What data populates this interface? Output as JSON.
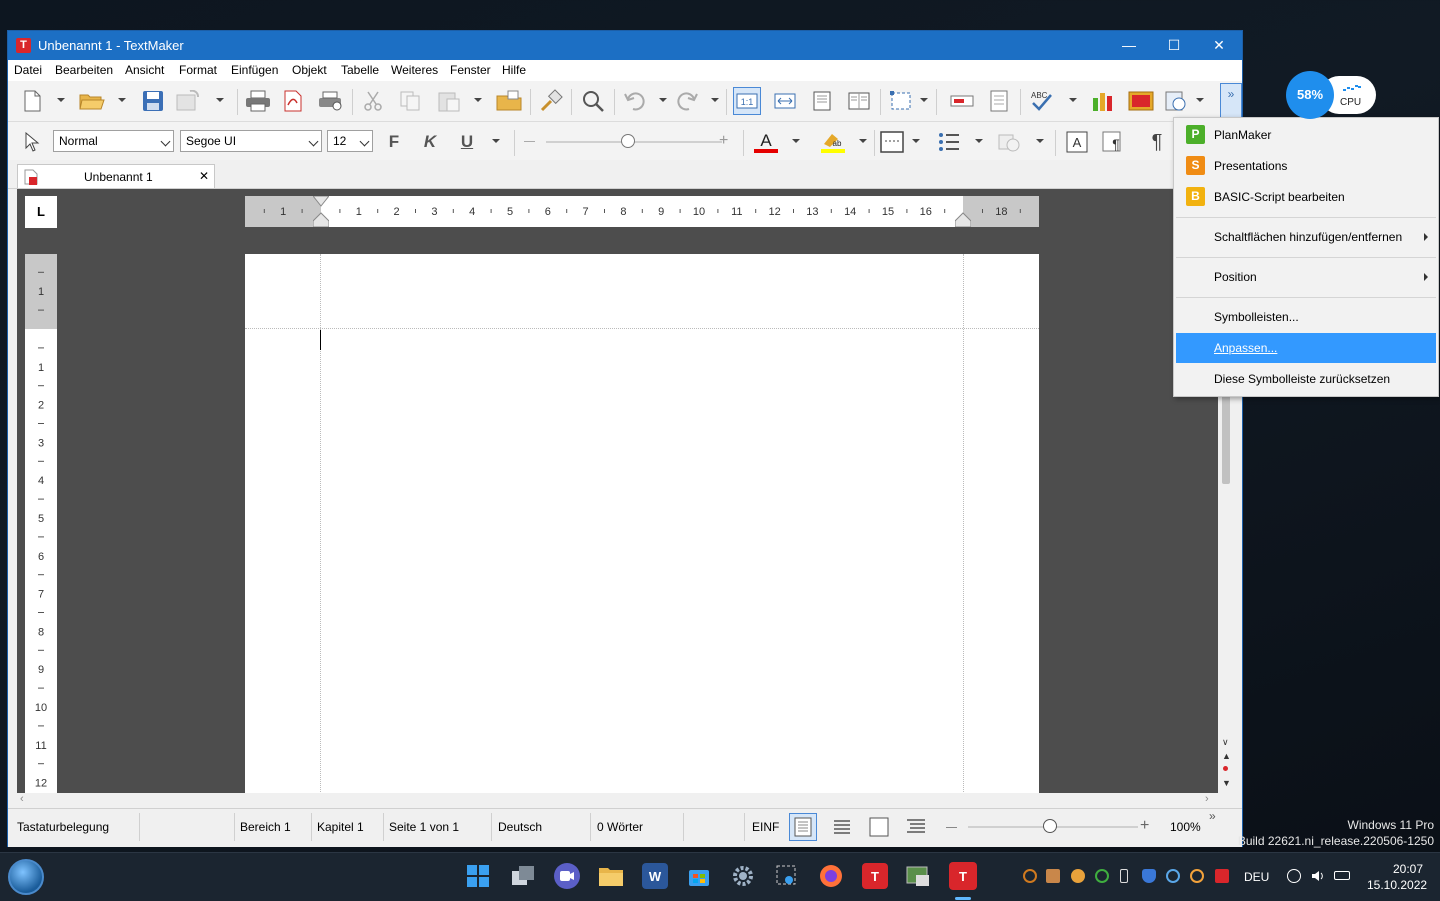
{
  "window": {
    "title": "Unbenannt 1 - TextMaker",
    "app_icon": "T",
    "controls": {
      "minimize": "—",
      "maximize": "☐",
      "close": "✕"
    }
  },
  "menu": [
    "Datei",
    "Bearbeiten",
    "Ansicht",
    "Format",
    "Einfügen",
    "Objekt",
    "Tabelle",
    "Weiteres",
    "Fenster",
    "Hilfe"
  ],
  "format_toolbar": {
    "style": "Normal",
    "font": "Segoe UI",
    "size": "12",
    "bold": "F",
    "italic": "K",
    "underline": "U"
  },
  "document_tab": {
    "label": "Unbenannt 1",
    "close": "✕"
  },
  "ruler": {
    "tab_stop_symbol": "L",
    "h_labels": [
      "1",
      "1",
      "2",
      "3",
      "4",
      "5",
      "6",
      "7",
      "8",
      "9",
      "10",
      "11",
      "12",
      "13",
      "14",
      "15",
      "16",
      "18"
    ],
    "v_labels": [
      "1",
      "1",
      "2",
      "3",
      "4",
      "5",
      "6",
      "7",
      "8",
      "9",
      "10",
      "11",
      "12"
    ]
  },
  "status_bar": {
    "keyboard": "Tastaturbelegung",
    "section": "Bereich 1",
    "chapter": "Kapitel 1",
    "page": "Seite 1 von 1",
    "language": "Deutsch",
    "words": "0 Wörter",
    "mode": "EINF",
    "zoom": "100%",
    "zoom_level": 1.0
  },
  "context_menu": {
    "apps": [
      {
        "label": "PlanMaker",
        "letter": "P",
        "color": "#4caf2a"
      },
      {
        "label": "Presentations",
        "letter": "S",
        "color": "#f08c14"
      },
      {
        "label": "BASIC-Script bearbeiten",
        "letter": "B",
        "color": "#f2b20f"
      }
    ],
    "add_remove": "Schaltflächen hinzufügen/entfernen",
    "position": "Position",
    "toolbars": "Symbolleisten...",
    "customize": "Anpassen...",
    "reset": "Diese Symbolleiste zurücksetzen"
  },
  "cpu_widget": {
    "percent": "58%",
    "label": "CPU"
  },
  "watermark": {
    "line1": "Windows 11 Pro",
    "line2": "Build 22621.ni_release.220506-1250"
  },
  "taskbar": {
    "language": "DEU",
    "time": "20:07",
    "date": "15.10.2022"
  },
  "colors": {
    "titlebar": "#1c6fc4",
    "highlight": "#3399ff",
    "textmaker_red": "#d9262b"
  }
}
